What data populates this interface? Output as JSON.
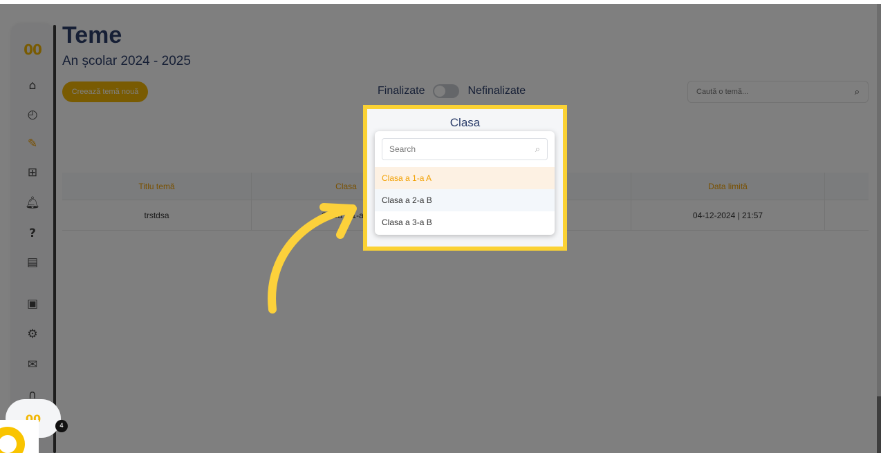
{
  "header": {
    "title": "Teme",
    "subtitle": "An școlar 2024 - 2025",
    "create_button": "Creează temă nouă"
  },
  "filter": {
    "left_label": "Finalizate",
    "right_label": "Nefinalizate"
  },
  "search": {
    "placeholder": "Caută o temă..."
  },
  "table": {
    "headers": [
      "Titlu temă",
      "Clasa",
      "",
      "Data limită",
      ""
    ],
    "rows": [
      [
        "trstdsa",
        "Clasa a 1-a A",
        "",
        "04-12-2024 | 21:57",
        ""
      ]
    ]
  },
  "dropdown": {
    "title": "Clasa",
    "search_placeholder": "Search",
    "options": [
      "Clasa a 1-a A",
      "Clasa a 2-a B",
      "Clasa a 3-a B"
    ],
    "selected_index": 0,
    "hover_index": 1
  },
  "help": {
    "badge_count": "4",
    "logo_text": "00"
  },
  "colors": {
    "accent": "#f2b705",
    "highlight": "#fbd234",
    "title": "#2c3e6b"
  }
}
